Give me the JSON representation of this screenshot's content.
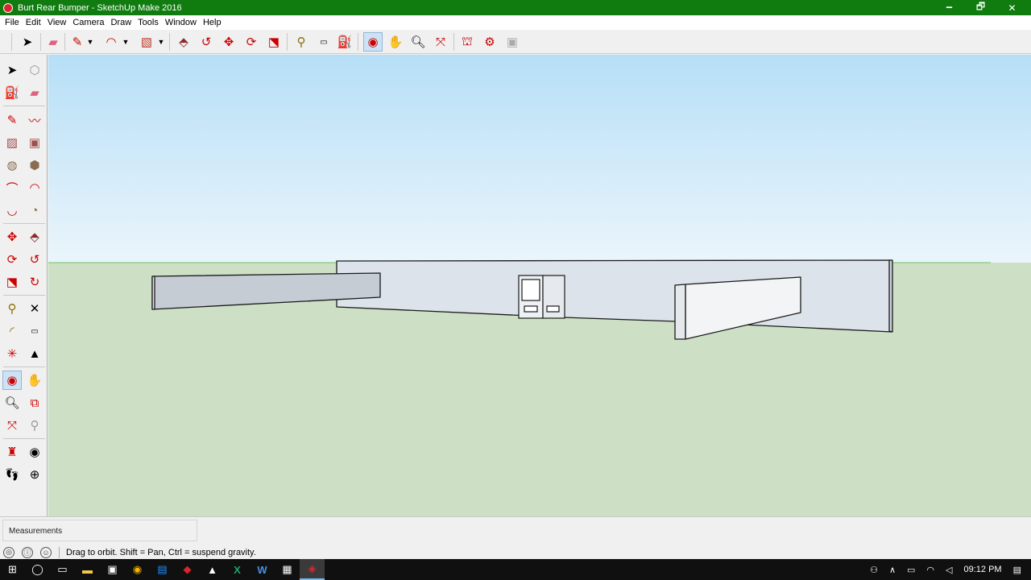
{
  "window": {
    "title": "Burt Rear Bumper - SketchUp Make 2016",
    "minimize": "🗕",
    "restore": "🗗",
    "close": "✕"
  },
  "menu": [
    "File",
    "Edit",
    "View",
    "Camera",
    "Draw",
    "Tools",
    "Window",
    "Help"
  ],
  "toolbar": {
    "icons": [
      "select-icon",
      "eraser-icon",
      "line-tool-icon",
      "dropdown-arrow-icon",
      "arc-tool-icon",
      "dropdown-arrow-icon",
      "rectangle-tool-icon",
      "dropdown-arrow-icon",
      "push-pull-icon",
      "follow-me-icon",
      "move-icon",
      "rotate-icon",
      "scale-icon",
      "tape-measure-icon",
      "text-tool-icon",
      "paint-bucket-icon",
      "orbit-icon",
      "pan-icon",
      "zoom-icon",
      "zoom-extents-icon",
      "warehouse-icon",
      "extension-warehouse-icon",
      "layout-icon"
    ],
    "active": "orbit-icon"
  },
  "lefttools": {
    "active": "orbit-icon",
    "icons": [
      "select-icon",
      "make-component-icon",
      "paint-bucket-icon",
      "eraser-icon",
      "line-tool-icon",
      "freehand-icon",
      "rectangle-tool-icon",
      "rotated-rectangle-icon",
      "circle-tool-icon",
      "polygon-tool-icon",
      "arc-tool-icon",
      "two-point-arc-icon",
      "three-point-arc-icon",
      "pie-icon",
      "move-icon",
      "push-pull-icon",
      "rotate-icon",
      "follow-me-icon",
      "scale-icon",
      "offset-icon",
      "tape-measure-icon",
      "dimension-icon",
      "protractor-icon",
      "text-tool-icon",
      "axes-icon",
      "3d-text-icon",
      "orbit-icon",
      "pan-icon",
      "zoom-icon",
      "zoom-window-icon",
      "zoom-extents-icon",
      "previous-view-icon",
      "position-camera-icon",
      "look-around-icon",
      "walk-icon",
      "section-plane-icon"
    ]
  },
  "colors": {
    "title_bar": "#107c10",
    "sky_top": "#b6dff7",
    "sky_bottom": "#ebf5fb",
    "ground": "#cde0c6",
    "model_face": "#dde3ea",
    "model_edge": "#1a1a1a"
  },
  "measurements": {
    "label": "Measurements"
  },
  "status": {
    "text": "Drag to orbit. Shift = Pan, Ctrl = suspend gravity."
  },
  "taskbar": {
    "apps": [
      "windows-start-icon",
      "cortana-search-icon",
      "task-view-icon",
      "file-explorer-icon",
      "media-app-icon",
      "chrome-icon",
      "outlook-icon",
      "app-icon",
      "photos-icon",
      "excel-icon",
      "word-icon",
      "calculator-icon",
      "sketchup-icon"
    ],
    "active": "sketchup-icon",
    "clock": "09:12 PM"
  }
}
